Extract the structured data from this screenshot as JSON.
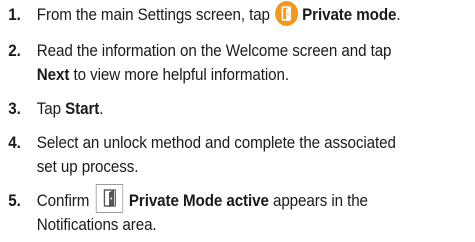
{
  "steps": [
    {
      "number": "1.",
      "text_before": "From the main Settings screen, tap",
      "icon": "private-mode-icon",
      "bold": "Private mode",
      "text_after": "."
    },
    {
      "number": "2.",
      "line1": "Read the information on the Welcome screen and tap",
      "bold": "Next",
      "text_after": " to view more helpful information."
    },
    {
      "number": "3.",
      "text_before": "Tap ",
      "bold": "Start",
      "text_after": "."
    },
    {
      "number": "4.",
      "line1": "Select an unlock method and complete the associated",
      "line2": "set up process."
    },
    {
      "number": "5.",
      "text_before": "Confirm",
      "icon": "private-mode-notification-icon",
      "bold": "Private Mode active",
      "text_after": " appears in the",
      "line2": "Notifications area."
    }
  ],
  "colors": {
    "accent_orange": "#f39a1e",
    "text": "#1a1a1a"
  }
}
